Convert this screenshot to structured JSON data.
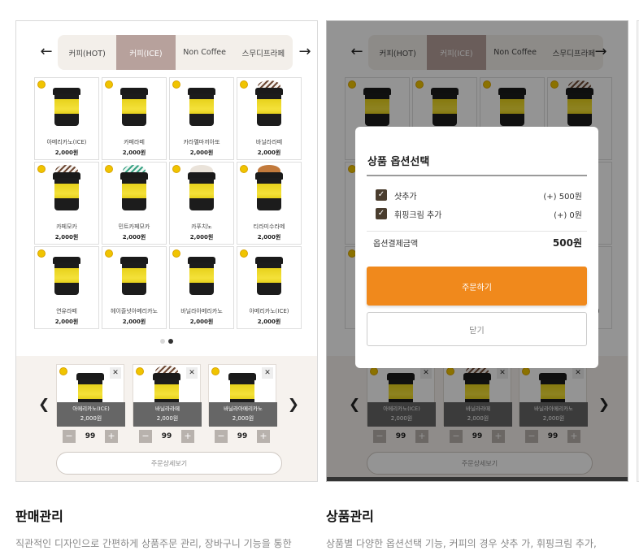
{
  "sales": {
    "tabs": [
      {
        "label": "커피(HOT)",
        "active": false
      },
      {
        "label": "커피(ICE)",
        "active": true
      },
      {
        "label": "Non Coffee",
        "active": false
      },
      {
        "label": "스무디프라페",
        "active": false
      }
    ],
    "products": [
      {
        "name": "아메리카노(ICE)",
        "price": "2,000원",
        "top": "none"
      },
      {
        "name": "카페라떼",
        "price": "2,000원",
        "top": "none"
      },
      {
        "name": "카라멜마끼아또",
        "price": "2,000원",
        "top": "none"
      },
      {
        "name": "바닐라라떼",
        "price": "2,000원",
        "top": "cream"
      },
      {
        "name": "카페모카",
        "price": "2,000원",
        "top": "cream"
      },
      {
        "name": "민트카페모카",
        "price": "2,000원",
        "top": "mint"
      },
      {
        "name": "카푸치노",
        "price": "2,000원",
        "top": "latte"
      },
      {
        "name": "티라미수라떼",
        "price": "2,000원",
        "top": "tira"
      },
      {
        "name": "연유라떼",
        "price": "2,000원",
        "top": "yogurt"
      },
      {
        "name": "헤이즐넛아메리카노",
        "price": "2,000원",
        "top": "none"
      },
      {
        "name": "바닐라아메리카노",
        "price": "2,000원",
        "top": "none"
      },
      {
        "name": "아메리카노(ICE)",
        "price": "2,000원",
        "top": "none"
      }
    ],
    "cart": [
      {
        "name": "아메리카노(ICE)",
        "price": "2,000원",
        "qty": "99",
        "top": "none"
      },
      {
        "name": "바닐라라떼",
        "price": "2,000원",
        "qty": "99",
        "top": "cream"
      },
      {
        "name": "바닐라아메리카노",
        "price": "2,000원",
        "qty": "99",
        "top": "none"
      }
    ],
    "detail_label": "주문상세보기",
    "heading": "판매관리",
    "description": "직관적인 디자인으로 간편하게 상품주문 관리, 장바구니 기능을 통한"
  },
  "product": {
    "tabs": [
      {
        "label": "커피(HOT)",
        "active": false
      },
      {
        "label": "커피(ICE)",
        "active": true
      },
      {
        "label": "Non Coffee",
        "active": false
      },
      {
        "label": "스무디프라페",
        "active": false
      }
    ],
    "modal": {
      "title": "상품 옵션선택",
      "options": [
        {
          "label": "샷추가",
          "value": "(+) 500원",
          "checked": true
        },
        {
          "label": "휘핑크림 추가",
          "value": "(+) 0원",
          "checked": true
        }
      ],
      "total_label": "옵션결제금액",
      "total_value": "500원",
      "order_label": "주문하기",
      "close_label": "닫기"
    },
    "cart": [
      {
        "name": "아메리카노(ICE)",
        "price": "2,000원",
        "qty": "99",
        "top": "none"
      },
      {
        "name": "바닐라라떼",
        "price": "2,000원",
        "qty": "99",
        "top": "cream"
      },
      {
        "name": "바닐라아메리카노",
        "price": "2,000원",
        "qty": "99",
        "top": "none"
      }
    ],
    "detail_label": "주문상세보기",
    "heading": "상품관리",
    "description": "상품별 다양한 옵션선택 기능, 커피의 경우 샷추 가, 휘핑크림 추가,"
  },
  "colors": {
    "accent": "#f0891c",
    "active_tab": "#b7a19c",
    "checkbox": "#4a3d2e",
    "badge": "#f0c400"
  },
  "icons": {
    "prev": "arrow-left-icon",
    "next": "arrow-right-icon",
    "remove": "close-icon",
    "minus": "minus-icon",
    "plus": "plus-icon",
    "check": "checkbox-checked-icon"
  }
}
